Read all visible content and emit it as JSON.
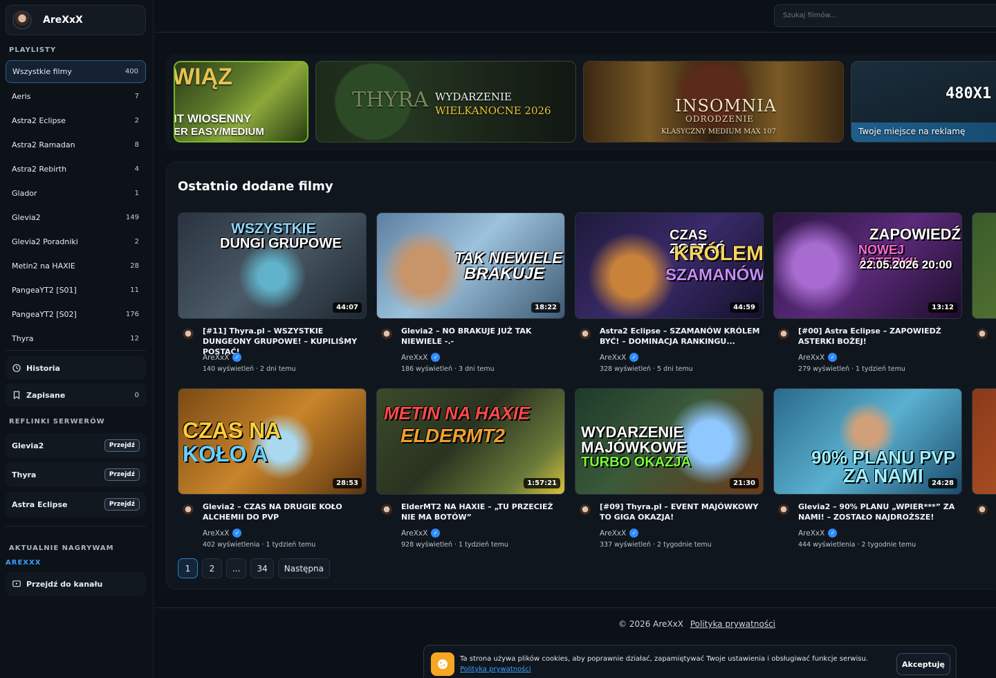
{
  "sidebar": {
    "brand_name": "AreXxX",
    "playlists_title": "PLAYLISTY",
    "playlists": [
      {
        "label": "Wszystkie filmy",
        "count": "400"
      },
      {
        "label": "Aeris",
        "count": "7"
      },
      {
        "label": "Astra2 Eclipse",
        "count": "2"
      },
      {
        "label": "Astra2 Ramadan",
        "count": "8"
      },
      {
        "label": "Astra2 Rebirth",
        "count": "4"
      },
      {
        "label": "Glador",
        "count": "1"
      },
      {
        "label": "Glevia2",
        "count": "149"
      },
      {
        "label": "Glevia2 Poradniki",
        "count": "2"
      },
      {
        "label": "Metin2 na HAXIE",
        "count": "28"
      },
      {
        "label": "PangeaYT2 [S01]",
        "count": "11"
      },
      {
        "label": "PangeaYT2 [S02]",
        "count": "176"
      },
      {
        "label": "Thyra",
        "count": "12"
      }
    ],
    "history_label": "Historia",
    "saved_label": "Zapisane",
    "saved_count": "0",
    "refs_title": "REFLINKI SERWERÓW",
    "refs": [
      {
        "label": "Glevia2",
        "go": "Przejdź"
      },
      {
        "label": "Thyra",
        "go": "Przejdź"
      },
      {
        "label": "Astra Eclipse",
        "go": "Przejdź"
      }
    ],
    "now_recording_title": "AKTUALNIE NAGRYWAM",
    "now_recording_name": "AREXXX",
    "channel_label": "Przejdź do kanału"
  },
  "search": {
    "placeholder": "Szukaj filmów..."
  },
  "banners": {
    "b1": {
      "l0": "WIĄZ",
      "l1": "IT WIOSENNY",
      "l2": "ER EASY/MEDIUM"
    },
    "b2": {
      "logo": "THYRA",
      "l1": "WYDARZENIE",
      "l2": "WIELKANOCNE 2026"
    },
    "b3": {
      "l1": "INSOMNIA",
      "l2": "ODRODZENIE",
      "l3": "KLASYCZNY MEDIUM MAX 107"
    },
    "b4": {
      "l1": "480X1",
      "l2": "Twoje miejsce na reklamę"
    }
  },
  "recent": {
    "title": "Ostatnio dodane filmy",
    "videos": [
      {
        "thumb_text": "WSZYSTKIE\nDUNGI GRUPOWE",
        "duration": "44:07",
        "title": "[#11] Thyra.pl – WSZYSTKIE DUNGEONY GRUPOWE! – KUPILIŚMY POSTAĆ!",
        "channel": "AreXxX",
        "views": "140 wyświetleń",
        "ago": "2 dni temu"
      },
      {
        "thumb_text": "TAK NIEWIELE\nBRAKUJE",
        "duration": "18:22",
        "title": "Glevia2 – NO BRAKUJE JUŻ TAK NIEWIELE -.-",
        "channel": "AreXxX",
        "views": "186 wyświetleń",
        "ago": "3 dni temu"
      },
      {
        "thumb_text": "CZAS ZOSTAĆ\nKRÓLEM\nSZAMANÓW!",
        "duration": "44:59",
        "title": "Astra2 Eclipse – SZAMANÓW KRÓLEM BYĆ! – DOMINACJA RANKINGU...",
        "channel": "AreXxX",
        "views": "328 wyświetleń",
        "ago": "5 dni temu"
      },
      {
        "thumb_text": "ZAPOWIEDŹ\nNOWEJ ASTERKI!\n22.05.2026 20:00",
        "duration": "13:12",
        "title": "[#00] Astra Eclipse – ZAPOWIEDŹ ASTERKI BOŻEJ!",
        "channel": "AreXxX",
        "views": "279 wyświetleń",
        "ago": "1 tydzień temu"
      },
      {
        "thumb_text": "CZAS NA\nKOŁO A",
        "duration": "28:53",
        "title": "Glevia2 – CZAS NA DRUGIE KOŁO ALCHEMII DO PVP",
        "channel": "AreXxX",
        "views": "402 wyświetlenia",
        "ago": "1 tydzień temu"
      },
      {
        "thumb_text": "METIN NA HAXIE\nELDERMT2",
        "duration": "1:57:21",
        "title": "ElderMT2 NA HAXIE – „TU PRZECIEŻ NIE MA BOTÓW”",
        "channel": "AreXxX",
        "views": "928 wyświetleń",
        "ago": "1 tydzień temu"
      },
      {
        "thumb_text": "WYDARZENIE\nMAJÓWKOWE\nTURBO OKAZJA",
        "duration": "21:30",
        "title": "[#09] Thyra.pl – EVENT MAJÓWKOWY TO GIGA OKAZJA!",
        "channel": "AreXxX",
        "views": "337 wyświetleń",
        "ago": "2 tygodnie temu"
      },
      {
        "thumb_text": "90% PLANU PVP\nZA NAMI",
        "duration": "24:28",
        "title": "Glevia2 – 90% PLANU „WPIER***” ZA NAMI! – ZOSTAŁO NAJDROŻSZE!",
        "channel": "AreXxX",
        "views": "444 wyświetlenia",
        "ago": "2 tygodnie temu"
      }
    ]
  },
  "pager": {
    "p1": "1",
    "p2": "2",
    "dots": "...",
    "last": "34",
    "next": "Następna"
  },
  "footer": {
    "copy": "© 2026 AreXxX",
    "privacy": "Polityka prywatności"
  },
  "cookie": {
    "text": "Ta strona używa plików cookies, aby poprawnie działać, zapamiętywać Twoje ustawienia i obsługiwać funkcje serwisu.",
    "link": "Polityka prywatności",
    "accept": "Akceptuję"
  },
  "colors": {
    "accent": "#3aa0ff",
    "cookie_icon": "#f5a623",
    "verified": "#2f8cff"
  }
}
